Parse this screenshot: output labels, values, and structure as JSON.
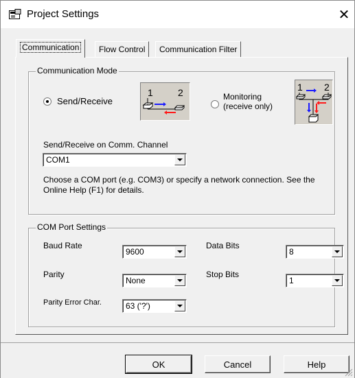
{
  "window": {
    "title": "Project Settings",
    "close_label": "✕"
  },
  "tabs": [
    {
      "label": "Communication"
    },
    {
      "label": "Flow Control"
    },
    {
      "label": "Communication Filter"
    }
  ],
  "comm_mode": {
    "title": "Communication Mode",
    "send_receive_label": "Send/Receive",
    "monitoring_label_line1": "Monitoring",
    "monitoring_label_line2": "(receive only)",
    "selected": "Send/Receive",
    "diagram1": {
      "label1": "1",
      "label2": "2"
    },
    "diagram2": {
      "label1": "1",
      "label2": "2"
    },
    "arrow_colors": {
      "blue": "#1a1aff",
      "red": "#ff1a1a"
    },
    "channel_label": "Send/Receive on Comm. Channel",
    "channel_value": "COM1",
    "help_text": "Choose a COM port (e.g. COM3) or specify a network connection. See the Online Help (F1) for details."
  },
  "port_settings": {
    "title": "COM Port Settings",
    "baud_rate_label": "Baud Rate",
    "baud_rate_value": "9600",
    "data_bits_label": "Data Bits",
    "data_bits_value": "8",
    "parity_label": "Parity",
    "parity_value": "None",
    "stop_bits_label": "Stop Bits",
    "stop_bits_value": "1",
    "parity_error_label": "Parity Error Char.",
    "parity_error_value": "63 ('?')"
  },
  "buttons": {
    "ok": "OK",
    "cancel": "Cancel",
    "help": "Help"
  }
}
